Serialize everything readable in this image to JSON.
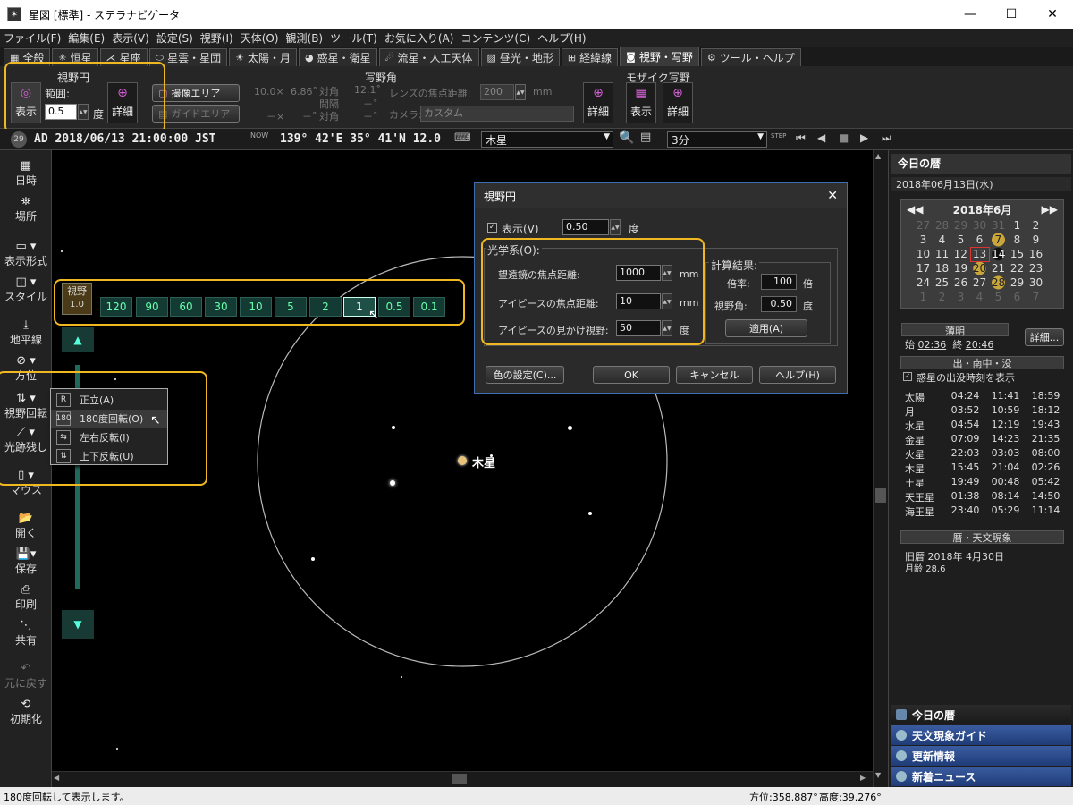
{
  "window": {
    "title": "星図 [標準] - ステラナビゲータ",
    "app_icon": "stellanavigator-icon"
  },
  "menu": [
    "ファイル(F)",
    "編集(E)",
    "表示(V)",
    "設定(S)",
    "視野(I)",
    "天体(O)",
    "観測(B)",
    "ツール(T)",
    "お気に入り(A)",
    "コンテンツ(C)",
    "ヘルプ(H)"
  ],
  "tabs": [
    {
      "label": "全般",
      "icon": "grid-icon"
    },
    {
      "label": "恒星",
      "icon": "star-icon"
    },
    {
      "label": "星座",
      "icon": "constellation-icon"
    },
    {
      "label": "星雲・星団",
      "icon": "nebula-icon"
    },
    {
      "label": "太陽・月",
      "icon": "sun-icon"
    },
    {
      "label": "惑星・衛星",
      "icon": "planet-icon"
    },
    {
      "label": "流星・人工天体",
      "icon": "meteor-icon"
    },
    {
      "label": "昼光・地形",
      "icon": "landscape-icon"
    },
    {
      "label": "経緯線",
      "icon": "gridlines-icon"
    },
    {
      "label": "視野・写野",
      "icon": "camera-icon"
    },
    {
      "label": "ツール・ヘルプ",
      "icon": "tools-icon"
    }
  ],
  "ribbon": {
    "fov_circle": {
      "group": "視野円",
      "show": "表示",
      "range_label": "範囲:",
      "range_value": "0.5",
      "unit": "度",
      "detail": "詳細"
    },
    "photo_field": {
      "group": "写野角",
      "imaging_area": "撮像エリア",
      "guide_area": "ガイドエリア",
      "w": "10.0×",
      "h": "6.86˚",
      "diag_label": "対角",
      "pitch_label": "間隔",
      "diag2_label": "対角",
      "v1": "12.1˚",
      "x1": "－×",
      "x2": "－˚",
      "x3": "－˚",
      "x4": "－˚",
      "lens_label": "レンズの焦点距離:",
      "lens_value": "200",
      "lens_unit": "mm",
      "camera_label": "カメラ:",
      "camera_value": "カスタム",
      "detail": "詳細"
    },
    "mosaic": {
      "group": "モザイク写野",
      "show": "表示",
      "detail": "詳細"
    }
  },
  "toolbar": {
    "datetime": "AD 2018/06/13 21:00:00 JST",
    "now_label": "NOW",
    "location": "139° 42'E 35° 41'N 12.0",
    "target": "木星",
    "step": "3分",
    "step_label": "STEP"
  },
  "leftbar": [
    {
      "label": "日時",
      "icon": "calendar-icon"
    },
    {
      "label": "場所",
      "icon": "location-icon"
    },
    {
      "label": "表示形式",
      "icon": "display-format-icon"
    },
    {
      "label": "スタイル",
      "icon": "style-icon"
    },
    {
      "label": "地平線",
      "icon": "horizon-icon"
    },
    {
      "label": "方位",
      "icon": "compass-icon"
    },
    {
      "label": "視野回転",
      "icon": "rotate-view-icon"
    },
    {
      "label": "光跡残し",
      "icon": "trail-icon"
    },
    {
      "label": "マウス",
      "icon": "mouse-icon"
    },
    {
      "label": "開く",
      "icon": "open-icon"
    },
    {
      "label": "保存",
      "icon": "save-icon"
    },
    {
      "label": "印刷",
      "icon": "print-icon"
    },
    {
      "label": "共有",
      "icon": "share-icon"
    },
    {
      "label": "元に戻す",
      "icon": "undo-icon"
    },
    {
      "label": "初期化",
      "icon": "reset-icon"
    }
  ],
  "fov_bar": {
    "label": "視野",
    "current": "1.0",
    "values": [
      "120",
      "90",
      "60",
      "30",
      "10",
      "5",
      "2",
      "1",
      "0.5",
      "0.1"
    ],
    "selected": "1"
  },
  "sky": {
    "jupiter_label": "木星"
  },
  "context_menu": [
    {
      "label": "正立(A)",
      "icon": "R"
    },
    {
      "label": "180度回転(O)",
      "icon": "180"
    },
    {
      "label": "左右反転(I)",
      "icon": "LR"
    },
    {
      "label": "上下反転(U)",
      "icon": "UD"
    }
  ],
  "dialog": {
    "title": "視野円",
    "show_label": "表示(V)",
    "show_value": "0.50",
    "deg": "度",
    "optics_label": "光学系(O):",
    "telescope_label": "望遠鏡の焦点距離:",
    "telescope_value": "1000",
    "eyepiece_label": "アイピースの焦点距離:",
    "eyepiece_value": "10",
    "apparent_label": "アイピースの見かけ視野:",
    "apparent_value": "50",
    "mm": "mm",
    "result_label": "計算結果:",
    "mag_label": "倍率:",
    "mag_value": "100",
    "mag_unit": "倍",
    "fov_label": "視野角:",
    "fov_value": "0.50",
    "fov_unit": "度",
    "apply": "適用(A)",
    "color": "色の設定(C)...",
    "ok": "OK",
    "cancel": "キャンセル",
    "help": "ヘルプ(H)"
  },
  "right_panel": {
    "title": "今日の暦",
    "date": "2018年06月13日(水)",
    "month": "2018年6月",
    "weeks": [
      [
        "27",
        "28",
        "29",
        "30",
        "31",
        "1",
        "2"
      ],
      [
        "3",
        "4",
        "5",
        "6",
        "7",
        "8",
        "9"
      ],
      [
        "10",
        "11",
        "12",
        "13",
        "14",
        "15",
        "16"
      ],
      [
        "17",
        "18",
        "19",
        "20",
        "21",
        "22",
        "23"
      ],
      [
        "24",
        "25",
        "26",
        "27",
        "28",
        "29",
        "30"
      ],
      [
        "1",
        "2",
        "3",
        "4",
        "5",
        "6",
        "7"
      ]
    ],
    "twilight_label": "薄明",
    "twilight_start_label": "始",
    "twilight_start": "02:36",
    "twilight_end_label": "終",
    "twilight_end": "20:46",
    "twilight_detail": "詳細...",
    "rise_header": "出・南中・没",
    "rise_checkbox": "惑星の出没時刻を表示",
    "planets": [
      [
        "太陽",
        "04:24",
        "11:41",
        "18:59"
      ],
      [
        "月",
        "03:52",
        "10:59",
        "18:12"
      ],
      [
        "水星",
        "04:54",
        "12:19",
        "19:43"
      ],
      [
        "金星",
        "07:09",
        "14:23",
        "21:35"
      ],
      [
        "火星",
        "22:03",
        "03:03",
        "08:00"
      ],
      [
        "木星",
        "15:45",
        "21:04",
        "02:26"
      ],
      [
        "土星",
        "19:49",
        "00:48",
        "05:42"
      ],
      [
        "天王星",
        "01:38",
        "08:14",
        "14:50"
      ],
      [
        "海王星",
        "23:40",
        "05:29",
        "11:14"
      ]
    ],
    "calendar_header": "暦・天文現象",
    "lunar_label": "旧暦",
    "lunar_value": "2018年 4月30日",
    "moon_age_label": "月齢",
    "moon_age_value": "28.6",
    "nav": [
      "今日の暦",
      "天文現象ガイド",
      "更新情報",
      "新着ニュース"
    ]
  },
  "status": {
    "message": "180度回転して表示します。",
    "azimuth": "方位:358.887°",
    "altitude": "高度:39.276°"
  }
}
